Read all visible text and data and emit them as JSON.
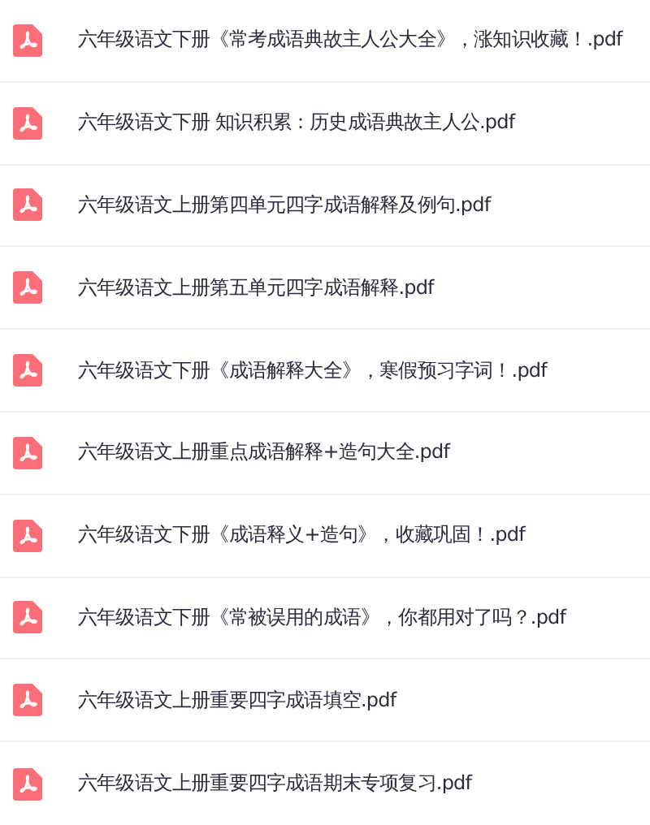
{
  "files": [
    {
      "name": "六年级语文下册《常考成语典故主人公大全》，涨知识收藏！.pdf"
    },
    {
      "name": "六年级语文下册 知识积累：历史成语典故主人公.pdf"
    },
    {
      "name": "六年级语文上册第四单元四字成语解释及例句.pdf"
    },
    {
      "name": "六年级语文上册第五单元四字成语解释.pdf"
    },
    {
      "name": "六年级语文下册《成语解释大全》，寒假预习字词！.pdf"
    },
    {
      "name": "六年级语文上册重点成语解释+造句大全.pdf"
    },
    {
      "name": "六年级语文下册《成语释义+造句》，收藏巩固！.pdf"
    },
    {
      "name": "六年级语文下册《常被误用的成语》，你都用对了吗？.pdf"
    },
    {
      "name": "六年级语文上册重要四字成语填空.pdf"
    },
    {
      "name": "六年级语文上册重要四字成语期末专项复习.pdf"
    }
  ]
}
